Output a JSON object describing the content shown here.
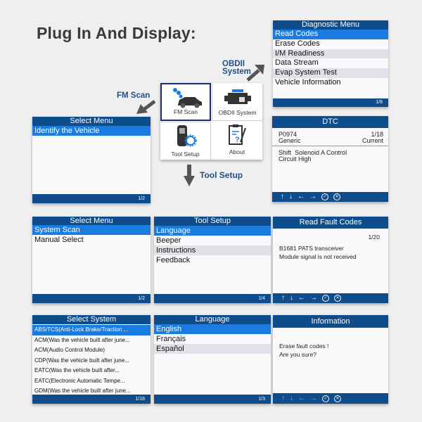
{
  "heading": "Plug In And Display:",
  "callouts": {
    "obdii": "OBDII\nSystem",
    "fm_scan": "FM Scan",
    "tool_setup": "Tool  Setup"
  },
  "main_menu": {
    "items": [
      {
        "label": "FM Scan",
        "icon": "car-icon",
        "selected": true
      },
      {
        "label": "OBDII System",
        "icon": "engine-icon",
        "selected": false
      },
      {
        "label": "Tool Setup",
        "icon": "scanner-gear-icon",
        "selected": false
      },
      {
        "label": "About",
        "icon": "clipboard-question-icon",
        "selected": false
      }
    ]
  },
  "colors": {
    "header": "#0f4c8c",
    "selected": "#1a7be0",
    "stripe": "#e1e1ea",
    "callout": "#1f4f8a"
  },
  "screens": [
    {
      "id": "diagnostic-menu",
      "type": "menu",
      "title": "Diagnostic Menu",
      "page": "1/6",
      "items": [
        {
          "text": "Read Codes",
          "state": "selected"
        },
        {
          "text": "Erase Codes",
          "state": ""
        },
        {
          "text": "I/M Readiness",
          "state": "striped"
        },
        {
          "text": "Data Stream",
          "state": ""
        },
        {
          "text": "Evap System Test",
          "state": "striped"
        },
        {
          "text": "Vehicle Information",
          "state": ""
        }
      ]
    },
    {
      "id": "dtc",
      "type": "dtc",
      "title": "DTC",
      "code": "P0974",
      "count": "1/18",
      "category": "Generic",
      "status": "Current",
      "description": "Shift  Solenoid A Control\nCircuit High",
      "nav": [
        "↑",
        "↓",
        "←",
        "→",
        "✓",
        "✕"
      ]
    },
    {
      "id": "select-menu-1",
      "type": "menu",
      "title": "Select Menu",
      "page": "1/2",
      "items": [
        {
          "text": "Identify the Vehicle",
          "state": "selected"
        }
      ]
    },
    {
      "id": "select-menu-2",
      "type": "menu",
      "title": "Select Menu",
      "page": "1/2",
      "items": [
        {
          "text": "System Scan",
          "state": "selected"
        },
        {
          "text": "Manual Select",
          "state": ""
        }
      ]
    },
    {
      "id": "tool-setup",
      "type": "menu",
      "title": "Tool Setup",
      "page": "1/4",
      "items": [
        {
          "text": "Language",
          "state": "selected"
        },
        {
          "text": "Beeper",
          "state": ""
        },
        {
          "text": "Instructions",
          "state": "striped"
        },
        {
          "text": "Feedback",
          "state": ""
        }
      ]
    },
    {
      "id": "read-fault-codes",
      "type": "message",
      "title": "Read Fault Codes",
      "count": "1/20",
      "lines": [
        "B1681 PATS transceiver",
        "Module signal is not received"
      ],
      "nav": [
        "↑",
        "↓",
        "←",
        "→",
        "✓",
        "✕"
      ]
    },
    {
      "id": "select-system",
      "type": "menu",
      "title": "Select System",
      "page": "1/16",
      "items": [
        {
          "text": "ABS/TCS(Anti-Lock Brake/Traction ...",
          "state": "selected"
        },
        {
          "text": "ACM(Was the vehicle built after june...",
          "state": ""
        },
        {
          "text": "ACM(Audio Control Module)",
          "state": ""
        },
        {
          "text": "CDP(Was the vehicle built after june...",
          "state": ""
        },
        {
          "text": "EATC(Was the vehicle built after...",
          "state": ""
        },
        {
          "text": "EATC(Electronic Automatic Tempe...",
          "state": ""
        },
        {
          "text": "GDM(Was the vehicle built after june...",
          "state": ""
        }
      ]
    },
    {
      "id": "language",
      "type": "menu",
      "title": "Language",
      "page": "1/3",
      "items": [
        {
          "text": "English",
          "state": "selected"
        },
        {
          "text": "Français",
          "state": ""
        },
        {
          "text": "Español",
          "state": "striped"
        }
      ]
    },
    {
      "id": "information",
      "type": "message",
      "title": "Information",
      "count": "",
      "lines": [
        "Erase fault codes !",
        "Are you sure?"
      ],
      "nav": [
        "↑",
        "↓",
        "←",
        "→",
        "✓",
        "✕"
      ]
    }
  ]
}
